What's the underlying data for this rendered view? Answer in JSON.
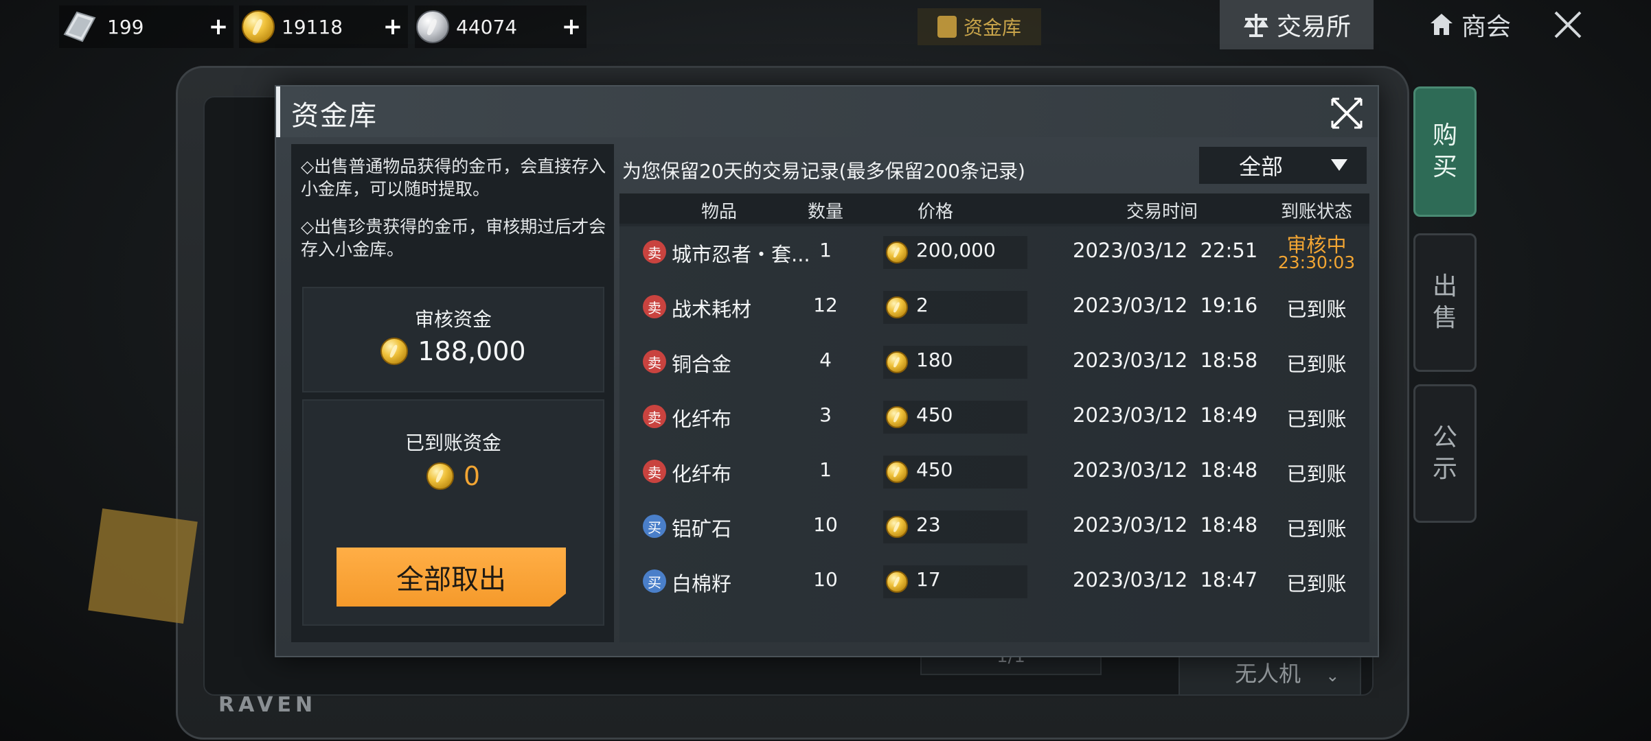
{
  "currency": {
    "gem": {
      "value": "199",
      "icon": "diamond-icon"
    },
    "gold": {
      "value": "19118",
      "icon": "gold-coin-icon"
    },
    "silver": {
      "value": "44074",
      "icon": "silver-coin-icon"
    },
    "add_label": "+"
  },
  "top_nav": {
    "vault": "资金库",
    "exchange": "交易所",
    "guild": "商会"
  },
  "side_tabs": {
    "buy": "购\n买",
    "sell": "出\n售",
    "notice": "公\n示"
  },
  "background": {
    "brand": "RAVEN",
    "pager": "1/1",
    "category": "无人机"
  },
  "dialog": {
    "title": "资金库",
    "info1": "◇出售普通物品获得的金币，会直接存入小金库，可以随时提取。",
    "info2": "◇出售珍贵获得的金币，审核期过后才会存入小金库。",
    "review_label": "审核资金",
    "review_value": "188,000",
    "arrived_label": "已到账资金",
    "arrived_value": "0",
    "withdraw_label": "全部取出",
    "records_note": "为您保留20天的交易记录(最多保留200条记录)",
    "filter_label": "全部"
  },
  "table": {
    "headers": {
      "item": "物品",
      "qty": "数量",
      "price": "价格",
      "time": "交易时间",
      "status": "到账状态"
    },
    "rows": [
      {
        "type": "卖",
        "kind": "sell",
        "name": "城市忍者・套...",
        "qty": "1",
        "price": "200,000",
        "time": "2023/03/12  22:51",
        "status": "审核中",
        "countdown": "23:30:03"
      },
      {
        "type": "卖",
        "kind": "sell",
        "name": "战术耗材",
        "qty": "12",
        "price": "2",
        "time": "2023/03/12  19:16",
        "status": "已到账"
      },
      {
        "type": "卖",
        "kind": "sell",
        "name": "铜合金",
        "qty": "4",
        "price": "180",
        "time": "2023/03/12  18:58",
        "status": "已到账"
      },
      {
        "type": "卖",
        "kind": "sell",
        "name": "化纤布",
        "qty": "3",
        "price": "450",
        "time": "2023/03/12  18:49",
        "status": "已到账"
      },
      {
        "type": "卖",
        "kind": "sell",
        "name": "化纤布",
        "qty": "1",
        "price": "450",
        "time": "2023/03/12  18:48",
        "status": "已到账"
      },
      {
        "type": "买",
        "kind": "buy",
        "name": "铝矿石",
        "qty": "10",
        "price": "23",
        "time": "2023/03/12  18:48",
        "status": "已到账"
      },
      {
        "type": "买",
        "kind": "buy",
        "name": "白棉籽",
        "qty": "10",
        "price": "17",
        "time": "2023/03/12  18:47",
        "status": "已到账"
      }
    ]
  },
  "colors": {
    "accent_orange": "#f59a2b",
    "pending": "#f2a533",
    "sell_tag": "#c9433f",
    "buy_tag": "#4a7fc9"
  }
}
